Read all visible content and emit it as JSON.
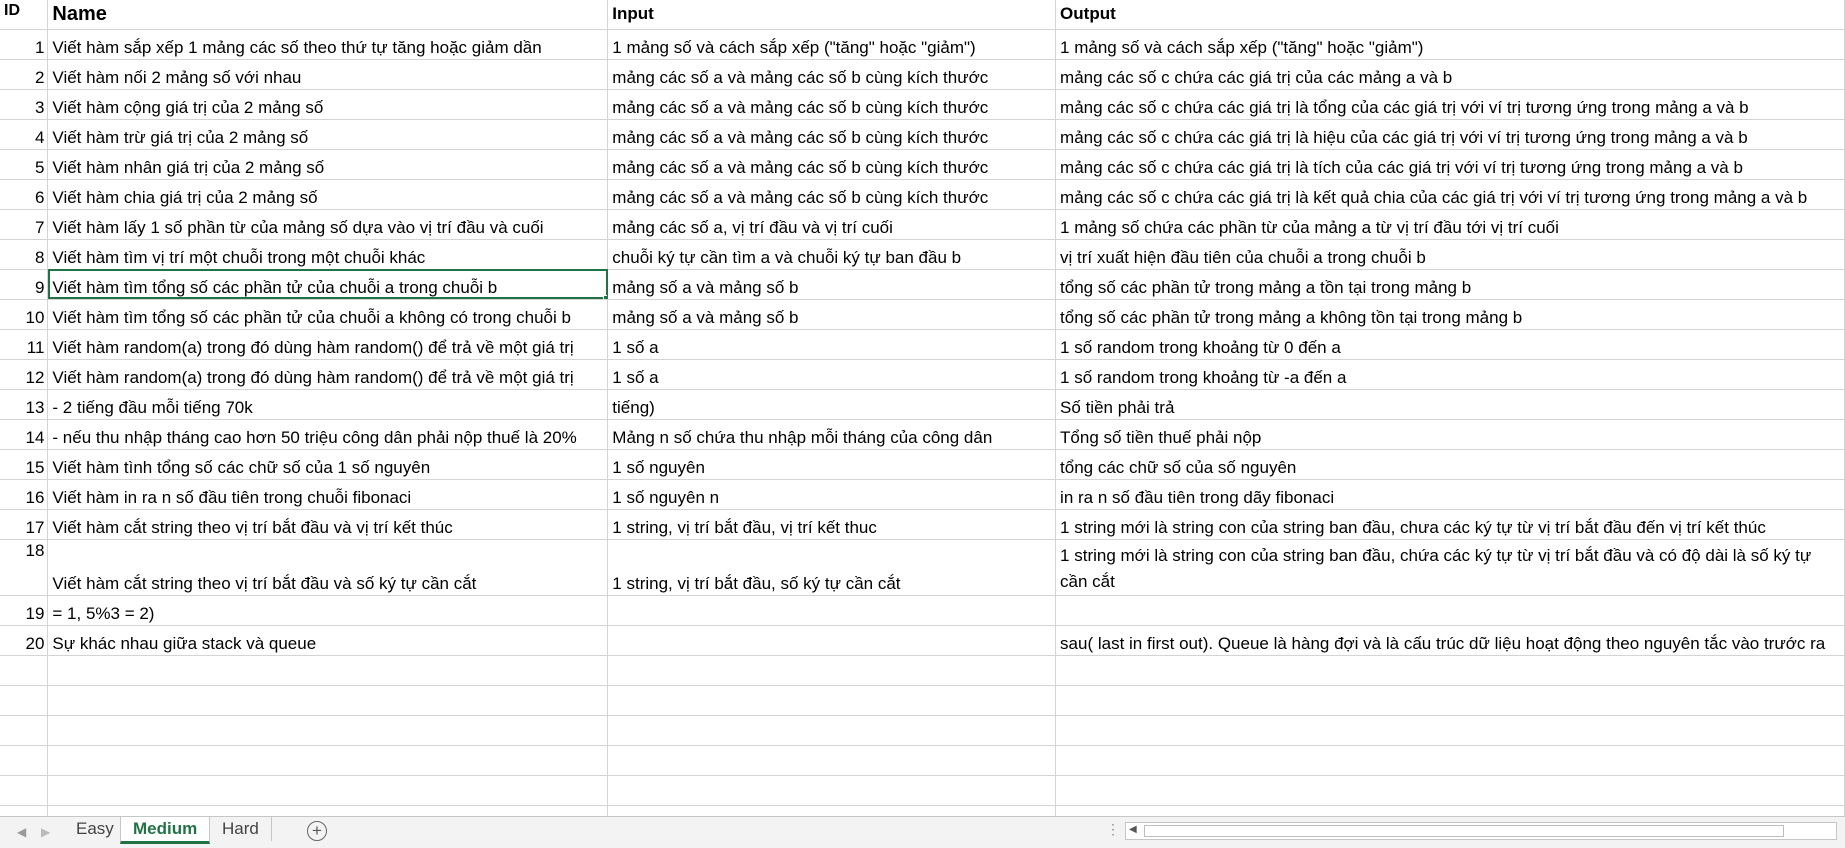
{
  "sheet": {
    "headers": {
      "id": "ID",
      "name": "Name",
      "input": "Input",
      "output": "Output"
    },
    "rows": [
      {
        "id": "1",
        "name": "Viết hàm sắp xếp 1 mảng các số theo thứ tự tăng hoặc giảm dần",
        "input": "1 mảng số và cách sắp xếp (\"tăng\" hoặc \"giảm\")",
        "output": "1 mảng số và cách sắp xếp (\"tăng\" hoặc \"giảm\")"
      },
      {
        "id": "2",
        "name": "Viết hàm nối 2 mảng số với nhau",
        "input": "mảng các số a và mảng các số b cùng kích thước",
        "output": "mảng các số c chứa các giá trị của các mảng a và b"
      },
      {
        "id": "3",
        "name": "Viết hàm cộng giá trị của 2 mảng số",
        "input": "mảng các số a và mảng các số b  cùng kích thước",
        "output": "mảng các số c chứa các giá trị là tổng của các giá trị với ví trị tương ứng trong mảng a và b"
      },
      {
        "id": "4",
        "name": "Viết hàm trừ giá trị của 2 mảng số",
        "input": "mảng các số a và mảng các số b  cùng kích thước",
        "output": "mảng các số c chứa các giá trị là hiệu của các giá trị với ví trị tương ứng trong mảng a và b"
      },
      {
        "id": "5",
        "name": "Viết hàm nhân giá trị của 2 mảng số",
        "input": "mảng các số a và mảng các số b  cùng kích thước",
        "output": "mảng các số c chứa các giá trị là tích của các giá trị với ví trị tương ứng trong mảng a và b"
      },
      {
        "id": "6",
        "name": "Viết hàm chia giá trị của 2 mảng số",
        "input": "mảng các số a và mảng các số b  cùng kích thước",
        "output": "mảng các số c chứa các giá trị là kết quả chia của các giá trị với ví trị tương ứng trong mảng a và b"
      },
      {
        "id": "7",
        "name": "Viết hàm lấy 1 số phần từ của mảng số dựa vào vị trí đầu và cuối",
        "input": "mảng các số a, vị trí đầu và vị trí cuối",
        "output": "1 mảng số chứa các phần từ của mảng a từ vị trí đầu tới vị trí cuối"
      },
      {
        "id": "8",
        "name": "Viết hàm tìm vị trí một chuỗi trong một chuỗi khác",
        "input": "chuỗi ký tự cần tìm a và chuỗi ký tự ban đầu b",
        "output": "vị trí xuất hiện đầu tiên của chuỗi a trong chuỗi b"
      },
      {
        "id": "9",
        "name": "Viết hàm tìm tổng số các phần tử của chuỗi a trong chuỗi b",
        "input": "mảng số a và mảng  số b",
        "output": "tổng số các phần tử trong mảng a tồn tại trong mảng b"
      },
      {
        "id": "10",
        "name": "Viết hàm tìm tổng số các phần tử của chuỗi a không có trong chuỗi b",
        "input": "mảng số a và mảng số b",
        "output": "tổng số các phần tử trong mảng a không tồn tại trong mảng b"
      },
      {
        "id": "11",
        "name": "Viết hàm random(a) trong đó dùng hàm random() để trả về một giá trị",
        "input": "1 số a",
        "output": "1 số random trong khoảng từ 0 đến a"
      },
      {
        "id": "12",
        "name": "Viết hàm random(a) trong đó dùng hàm random() để trả về một giá trị",
        "input": "1 số a",
        "output": "1 số random trong khoảng từ -a đến a"
      },
      {
        "id": "13",
        "name": " - 2 tiếng đầu mỗi tiếng 70k",
        "input": "tiếng)",
        "output": "Số tiền phải trả"
      },
      {
        "id": "14",
        "name": " - nếu thu nhập tháng cao hơn 50 triệu công dân phải nộp thuế là 20%",
        "input": "Mảng n số chứa thu nhập mỗi tháng của công dân",
        "output": "Tổng số tiền thuế phải nộp"
      },
      {
        "id": "15",
        "name": "Viết hàm tình tổng số các chữ số của 1 số nguyên",
        "input": "1 số nguyên",
        "output": "tổng các chữ số của số nguyên"
      },
      {
        "id": "16",
        "name": "Viết hàm in ra n số đầu tiên trong chuỗi fibonaci",
        "input": "1 số nguyên n",
        "output": "in ra n số đầu tiên trong dãy fibonaci"
      },
      {
        "id": "17",
        "name": "Viết hàm cắt string theo vị trí bắt đầu và vị trí kết thúc",
        "input": "1 string, vị trí bắt đầu, vị trí kết thuc",
        "output": "1 string mới là string con của string ban đầu, chưa các ký tự từ vị trí bắt đầu đến vị trí kết thúc"
      },
      {
        "id": "18",
        "name": "Viết hàm cắt string theo vị trí bắt đầu và số ký tự cần cắt",
        "input": "1 string, vị trí bắt đầu, số ký tự cần cắt",
        "output": "1 string mới là string con của string ban đầu, chứa các ký tự từ vị trí bắt đầu và có độ dài là số ký tự cần cắt"
      },
      {
        "id": "19",
        "name": "= 1, 5%3 = 2)",
        "input": "",
        "output": ""
      },
      {
        "id": "20",
        "name": "Sự khác nhau giữa stack và queue",
        "input": "",
        "output": "sau( last in first out). Queue là hàng đợi và là cấu trúc dữ liệu hoạt động theo nguyên tắc vào trước ra"
      }
    ],
    "empty_rows": 6,
    "selected_row": 9,
    "selected_col": "name"
  },
  "tabs": [
    {
      "label": "Easy",
      "active": false
    },
    {
      "label": "Medium",
      "active": true
    },
    {
      "label": "Hard",
      "active": false
    }
  ],
  "icons": {
    "add_sheet": "plus-circle-icon",
    "scroll_left": "arrow-left-icon"
  },
  "colors": {
    "accent": "#217346",
    "gridline": "#d4d4d4"
  }
}
